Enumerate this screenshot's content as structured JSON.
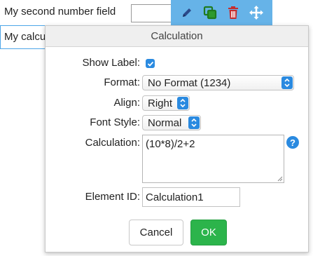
{
  "background": {
    "field1_label": "My second number field",
    "field2_label": "My calculation"
  },
  "toolbar": {
    "icons": [
      "pencil-icon",
      "copy-icon",
      "trash-icon",
      "move-icon"
    ]
  },
  "dialog": {
    "title": "Calculation",
    "show_label": {
      "label": "Show Label:",
      "checked": true
    },
    "format": {
      "label": "Format:",
      "value": "No Format (1234)"
    },
    "align": {
      "label": "Align:",
      "value": "Right"
    },
    "font_style": {
      "label": "Font Style:",
      "value": "Normal"
    },
    "calculation": {
      "label": "Calculation:",
      "value": "(10*8)/2+2"
    },
    "element_id": {
      "label": "Element ID:",
      "value": "Calculation1"
    },
    "cancel_label": "Cancel",
    "ok_label": "OK"
  },
  "colors": {
    "accent": "#2a8ae0",
    "toolbar": "#66b3e8",
    "ok": "#2cb44b",
    "delete": "#c62d2d"
  }
}
